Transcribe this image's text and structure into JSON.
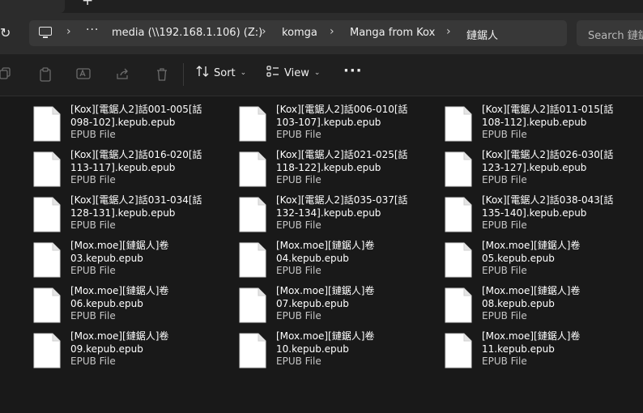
{
  "tabstrip": {
    "close_glyph": "✕",
    "new_tab_glyph": "+"
  },
  "addressbar": {
    "refresh_glyph": "↻",
    "ellipsis": "···",
    "breadcrumbs": [
      "media (\\\\192.168.1.106) (Z:)",
      "komga",
      "Manga from Kox",
      "鏈鋸人"
    ],
    "chevron": "›",
    "search_placeholder": "Search 鏈鋸人"
  },
  "toolbar": {
    "sort_label": "Sort",
    "view_label": "View",
    "more_label": "···",
    "icons": [
      "copy-icon",
      "paste-icon",
      "rename-icon",
      "share-icon",
      "delete-icon",
      "sort-icon",
      "view-icon",
      "more-icon"
    ]
  },
  "files": [
    {
      "name": "[Kox][電鋸人2]話001-005[話\n098-102].kepub.epub",
      "type": "EPUB File"
    },
    {
      "name": "[Kox][電鋸人2]話006-010[話\n103-107].kepub.epub",
      "type": "EPUB File"
    },
    {
      "name": "[Kox][電鋸人2]話011-015[話\n108-112].kepub.epub",
      "type": "EPUB File"
    },
    {
      "name": "[Kox][電鋸人2]話016-020[話\n113-117].kepub.epub",
      "type": "EPUB File"
    },
    {
      "name": "[Kox][電鋸人2]話021-025[話\n118-122].kepub.epub",
      "type": "EPUB File"
    },
    {
      "name": "[Kox][電鋸人2]話026-030[話\n123-127].kepub.epub",
      "type": "EPUB File"
    },
    {
      "name": "[Kox][電鋸人2]話031-034[話\n128-131].kepub.epub",
      "type": "EPUB File"
    },
    {
      "name": "[Kox][電鋸人2]話035-037[話\n132-134].kepub.epub",
      "type": "EPUB File"
    },
    {
      "name": "[Kox][電鋸人2]話038-043[話\n135-140].kepub.epub",
      "type": "EPUB File"
    },
    {
      "name": "[Mox.moe][鏈鋸人]卷\n03.kepub.epub",
      "type": "EPUB File"
    },
    {
      "name": "[Mox.moe][鏈鋸人]卷\n04.kepub.epub",
      "type": "EPUB File"
    },
    {
      "name": "[Mox.moe][鏈鋸人]卷\n05.kepub.epub",
      "type": "EPUB File"
    },
    {
      "name": "[Mox.moe][鏈鋸人]卷\n06.kepub.epub",
      "type": "EPUB File"
    },
    {
      "name": "[Mox.moe][鏈鋸人]卷\n07.kepub.epub",
      "type": "EPUB File"
    },
    {
      "name": "[Mox.moe][鏈鋸人]卷\n08.kepub.epub",
      "type": "EPUB File"
    },
    {
      "name": "[Mox.moe][鏈鋸人]卷\n09.kepub.epub",
      "type": "EPUB File"
    },
    {
      "name": "[Mox.moe][鏈鋸人]卷\n10.kepub.epub",
      "type": "EPUB File"
    },
    {
      "name": "[Mox.moe][鏈鋸人]卷\n11.kepub.epub",
      "type": "EPUB File"
    }
  ],
  "colors": {
    "background": "#191919",
    "addressbar": "#2c2c2c",
    "toolbar": "#1f1f1f",
    "doc_icon": "#ffffff"
  }
}
